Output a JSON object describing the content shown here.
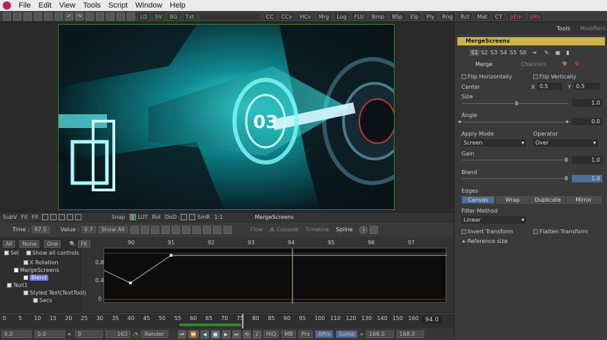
{
  "menu": [
    "File",
    "Edit",
    "View",
    "Tools",
    "Script",
    "Window",
    "Help"
  ],
  "toolbar": {
    "view_buttons": [
      "LD",
      "SV",
      "BG",
      "Txt"
    ],
    "tool_buttons": [
      "CC",
      "CCv",
      "HCv",
      "Mrg",
      "Log",
      "FLU",
      "Bmp",
      "BSp",
      "Elp",
      "Ply",
      "Rng",
      "Rct",
      "Mat",
      "CT",
      "pEm",
      "pRn"
    ]
  },
  "viewer": {
    "toolbar_left": [
      "SubV",
      "Fit",
      "Fit"
    ],
    "toolbar_mid": [
      "Snap",
      "LUT",
      "RoI",
      "DoD",
      "SmR",
      "1:1"
    ],
    "viewer_title": "MergeScreens",
    "image_number": "03"
  },
  "spline": {
    "time_label": "Time :",
    "time_value": "87.0",
    "value_label": "Value :",
    "value_value": "0.7",
    "show_label": "Show All",
    "tabs": [
      "Flow",
      "Console",
      "Timeline",
      "Spline"
    ],
    "filter_buttons": [
      "All",
      "None",
      "One",
      "Fit"
    ],
    "tree": [
      "Sel",
      "Show all controls",
      "X Rotation",
      "MergeScreens",
      "Blend",
      "Text1",
      "Styled Text(TextTool)",
      "Secs"
    ],
    "ruler_ticks": [
      "90",
      "91",
      "92",
      "93",
      "94",
      "95",
      "96",
      "97"
    ],
    "y_ticks": [
      "0.8",
      "0.4",
      "0"
    ]
  },
  "timeline": {
    "ticks": [
      "0",
      "5",
      "10",
      "15",
      "20",
      "25",
      "30",
      "35",
      "40",
      "45",
      "50",
      "55",
      "60",
      "65",
      "70",
      "75",
      "80",
      "85",
      "90",
      "95",
      "100",
      "110",
      "120",
      "130",
      "140",
      "150",
      "160"
    ],
    "end_value": "94.0"
  },
  "transport": {
    "start": "0.0",
    "start2": "0.0",
    "current": "0",
    "global": "163",
    "render": "Render",
    "hiq": "HiQ",
    "mb": "MB",
    "prx": "Prx",
    "aprx": "APrx",
    "some": "Some",
    "end": "168.0",
    "end2": "168.0"
  },
  "tools_panel": {
    "tabs": [
      "Tools",
      "Modifiers"
    ],
    "tool_name": "MergeScreens",
    "slots": [
      "S1",
      "S2",
      "S3",
      "S4",
      "S5",
      "S6"
    ],
    "subtabs": [
      "Merge",
      "Channels"
    ],
    "flip_h": "Flip Horizontally",
    "flip_v": "Flip Vertically",
    "center_label": "Center",
    "center_x_label": "X",
    "center_x": "0.5",
    "center_y_label": "Y",
    "center_y": "0.5",
    "size_label": "Size",
    "size_value": "1.0",
    "angle_label": "Angle",
    "angle_value": "0.0",
    "apply_mode_label": "Apply Mode",
    "apply_mode_value": "Screen",
    "operator_label": "Operator",
    "operator_value": "Over",
    "gain_label": "Gain",
    "gain_value": "1.0",
    "blend_label": "Blend",
    "blend_value": "1.0",
    "edges_label": "Edges",
    "edges": [
      "Canvas",
      "Wrap",
      "Duplicate",
      "Mirror"
    ],
    "filter_method_label": "Filter Method",
    "filter_method_value": "Linear",
    "invert_transform": "Invert Transform",
    "flatten_transform": "Flatten Transform",
    "reference_size": "Reference size"
  },
  "colors": {
    "accent": "#cfb44a",
    "graph_bg": "#0c0c0c",
    "cyan": "#27e0e6"
  }
}
